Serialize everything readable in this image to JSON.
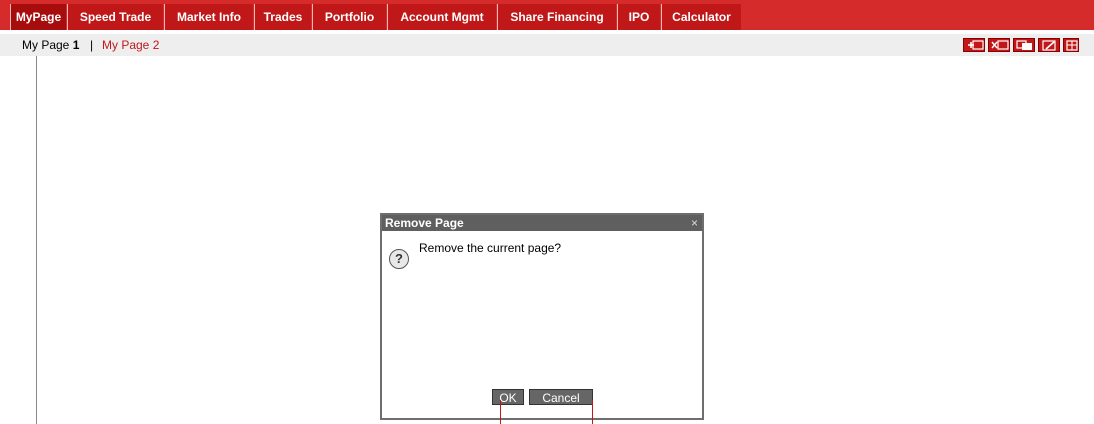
{
  "nav": {
    "tabs": [
      {
        "label": "MyPage",
        "active": true
      },
      {
        "label": "Speed Trade"
      },
      {
        "label": "Market Info"
      },
      {
        "label": "Trades"
      },
      {
        "label": "Portfolio"
      },
      {
        "label": "Account Mgmt"
      },
      {
        "label": "Share Financing"
      },
      {
        "label": "IPO"
      },
      {
        "label": "Calculator"
      }
    ]
  },
  "subbar": {
    "page1_label": "My Page ",
    "page1_num": "1",
    "separator": "|",
    "page2_label": "My Page 2",
    "tools": [
      "add-page-icon",
      "remove-page-icon",
      "copy-page-icon",
      "edit-page-icon",
      "layout-icon"
    ]
  },
  "dialog": {
    "title": "Remove Page",
    "close": "×",
    "icon": "?",
    "message": "Remove the current page?",
    "ok_label": "OK",
    "cancel_label": "Cancel"
  },
  "colors": {
    "nav_red": "#d62b2b",
    "tab_red": "#c01818",
    "dialog_gray": "#5f5f5f"
  }
}
